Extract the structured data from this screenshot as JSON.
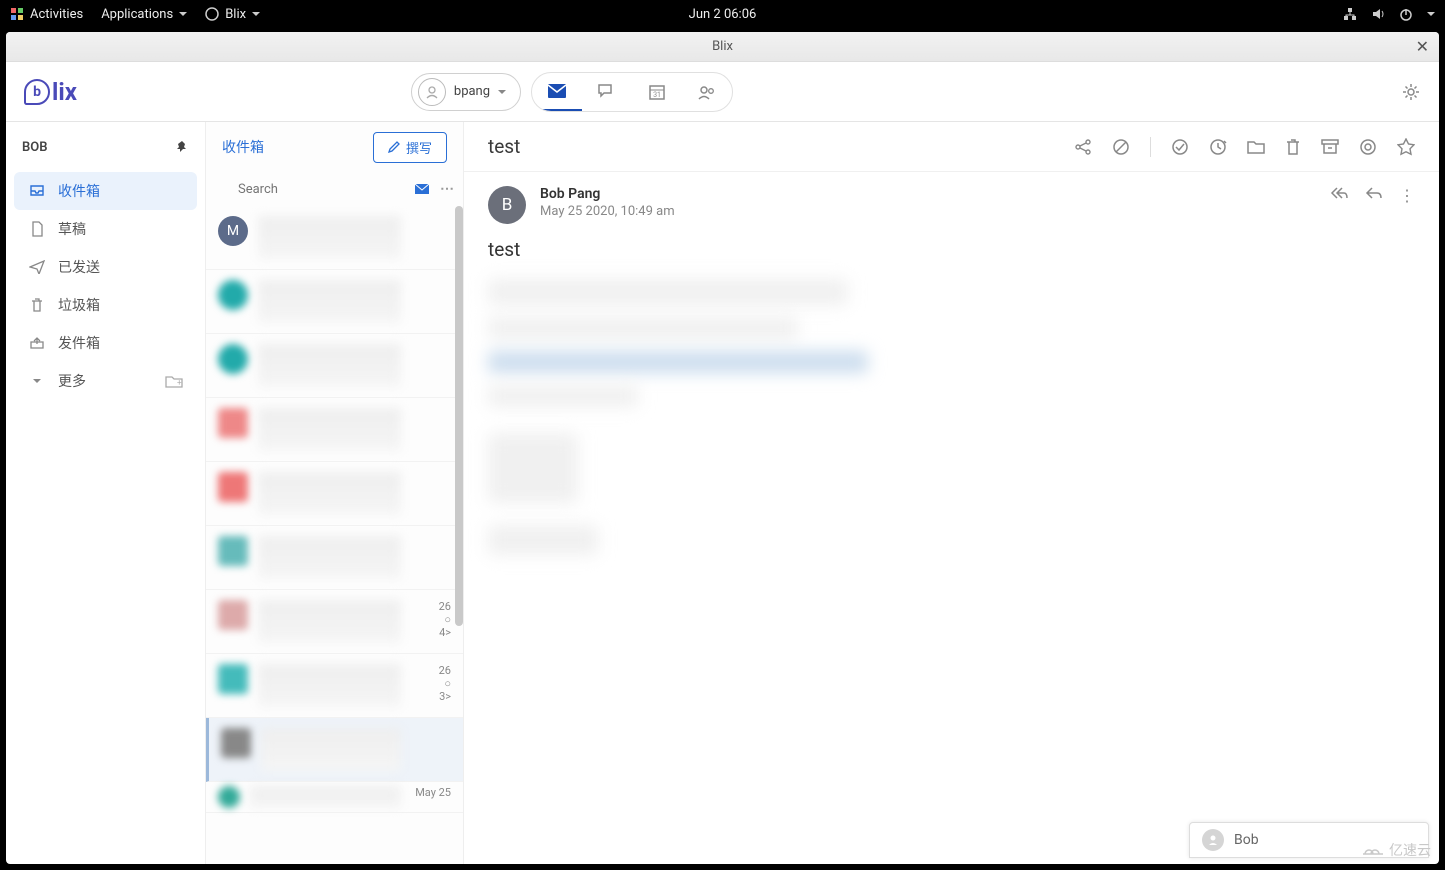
{
  "sysbar": {
    "activities": "Activities",
    "applications": "Applications",
    "app": "Blix",
    "clock": "Jun 2  06:06"
  },
  "window": {
    "title": "Blix"
  },
  "toolbar": {
    "logo": "lix",
    "account": "bpang"
  },
  "sidebar": {
    "account": "BOB",
    "folders": [
      {
        "label": "收件箱",
        "icon": "inbox",
        "active": true
      },
      {
        "label": "草稿",
        "icon": "draft",
        "active": false
      },
      {
        "label": "已发送",
        "icon": "sent",
        "active": false
      },
      {
        "label": "垃圾箱",
        "icon": "trash",
        "active": false
      },
      {
        "label": "发件箱",
        "icon": "outbox",
        "active": false
      }
    ],
    "more": "更多"
  },
  "list": {
    "title": "收件箱",
    "compose": "撰写",
    "search_placeholder": "Search",
    "items_meta": [
      {
        "date": "",
        "extra": ""
      },
      {
        "date": "",
        "extra": ""
      },
      {
        "date": "",
        "extra": ""
      },
      {
        "date": "",
        "extra": ""
      },
      {
        "date": "",
        "extra": ""
      },
      {
        "date": "",
        "extra": ""
      },
      {
        "date": "26",
        "extra": "4>"
      },
      {
        "date": "26",
        "extra": "3>"
      },
      {
        "date": "",
        "extra": ""
      },
      {
        "date": "May 25",
        "extra": ""
      }
    ]
  },
  "reader": {
    "subject": "test",
    "from": "Bob Pang",
    "date": "May 25 2020, 10:49 am",
    "body_subject": "test",
    "avatar_letter": "B"
  },
  "chat": {
    "name": "Bob"
  },
  "watermark": "亿速云"
}
